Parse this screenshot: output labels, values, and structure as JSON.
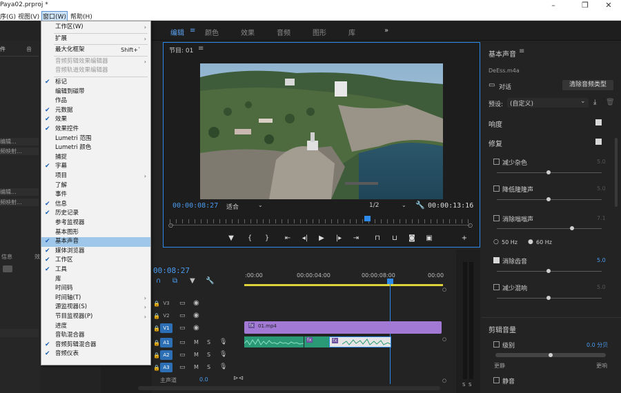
{
  "window": {
    "title": "Paya02.prproj *"
  },
  "menubar": [
    "序(G)",
    "视图(V)",
    "窗口(W)",
    "帮助(H)"
  ],
  "workspaces": [
    "编辑",
    "颜色",
    "效果",
    "音频",
    "图形",
    "库"
  ],
  "left_panel": {
    "tabs": [
      "件",
      "音"
    ],
    "rows": [
      "编辑...",
      "频映射...",
      "编辑...",
      "频映射..."
    ],
    "lower_tabs": [
      "信息",
      "效"
    ]
  },
  "program": {
    "title": "节目: 01",
    "timecode_left": "00:00:08:27",
    "fit": "适合",
    "resolution": "1/2",
    "timecode_right": "00:00:13:16"
  },
  "timeline": {
    "timecode": "00:08:27",
    "ruler": [
      ":00:00",
      "00:00:04:00",
      "00:00:08:00",
      "00:00"
    ],
    "tracks": [
      {
        "label": "V3",
        "kind": "video"
      },
      {
        "label": "V2",
        "kind": "video"
      },
      {
        "label": "V1",
        "kind": "video"
      },
      {
        "label": "A1",
        "kind": "audio"
      },
      {
        "label": "A2",
        "kind": "audio"
      },
      {
        "label": "A3",
        "kind": "audio"
      }
    ],
    "master": "主声道",
    "master_value": "0.0",
    "clip_name": "01.mp4"
  },
  "essential_sound": {
    "title": "基本声音",
    "file": "DeEss.m4a",
    "type_label": "对话",
    "clear_button": "清除音频类型",
    "preset_label": "预设:",
    "preset_value": "(自定义)",
    "loudness": "响度",
    "repair": "修复",
    "repair_items": [
      {
        "label": "减少杂色",
        "value": "5.0",
        "checked": false
      },
      {
        "label": "降低隆隆声",
        "value": "5.0",
        "checked": false
      },
      {
        "label": "消除嗡嗡声",
        "value": "7.1",
        "checked": false
      }
    ],
    "hz_options": [
      "50 Hz",
      "60 Hz"
    ],
    "deess": {
      "label": "消除齿音",
      "value": "5.0",
      "checked": true
    },
    "reverb": {
      "label": "减少混响",
      "value": "5.0",
      "checked": false
    },
    "clip_volume": "剪辑音量",
    "level_label": "级别",
    "level_value": "0.0 分贝",
    "quieter": "更静",
    "louder": "更响",
    "mute": "静音"
  },
  "window_menu": [
    {
      "label": "工作区(W)",
      "arrow": true
    },
    {
      "sep": true
    },
    {
      "label": "扩展",
      "arrow": true
    },
    {
      "sep": true
    },
    {
      "label": "最大化框架",
      "shortcut": "Shift+`"
    },
    {
      "sep": true
    },
    {
      "label": "音频剪辑效果编辑器",
      "disabled": true,
      "arrow": true
    },
    {
      "label": "音频轨道效果编辑器",
      "disabled": true
    },
    {
      "sep": true
    },
    {
      "label": "标记",
      "checked": true
    },
    {
      "label": "编辑到磁带"
    },
    {
      "label": "作品"
    },
    {
      "label": "元数据",
      "checked": true
    },
    {
      "label": "效果",
      "checked": true
    },
    {
      "label": "效果控件",
      "checked": true
    },
    {
      "label": "Lumetri 范围"
    },
    {
      "label": "Lumetri 颜色"
    },
    {
      "label": "捕捉"
    },
    {
      "label": "字幕",
      "checked": true
    },
    {
      "label": "项目",
      "arrow": true
    },
    {
      "label": "了解"
    },
    {
      "label": "事件"
    },
    {
      "label": "信息",
      "checked": true
    },
    {
      "label": "历史记录",
      "checked": true
    },
    {
      "label": "参考监视器"
    },
    {
      "label": "基本图形"
    },
    {
      "label": "基本声音",
      "checked": true,
      "highlight": true
    },
    {
      "label": "媒体浏览器",
      "checked": true
    },
    {
      "label": "工作区",
      "checked": true
    },
    {
      "label": "工具",
      "checked": true
    },
    {
      "label": "库"
    },
    {
      "label": "时间码"
    },
    {
      "label": "时间轴(T)",
      "arrow": true
    },
    {
      "label": "源监视器(S)",
      "arrow": true
    },
    {
      "label": "节目监视器(P)",
      "arrow": true
    },
    {
      "label": "进度"
    },
    {
      "label": "音轨混合器"
    },
    {
      "label": "音频剪辑混合器",
      "checked": true
    },
    {
      "label": "音频仪表",
      "checked": true
    }
  ]
}
